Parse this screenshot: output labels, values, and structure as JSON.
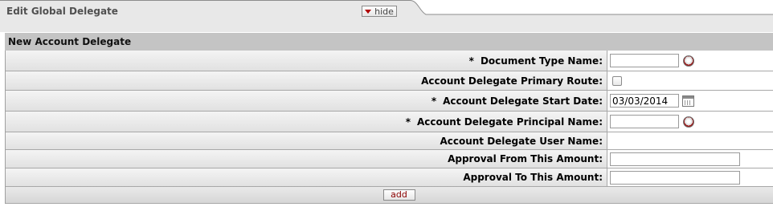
{
  "tab": {
    "title": "Edit Global Delegate",
    "hide_label": "hide"
  },
  "section": {
    "title": "New Account Delegate"
  },
  "fields": [
    {
      "label": "Document Type Name:",
      "required": "*",
      "value": ""
    },
    {
      "label": "Account Delegate Primary Route:",
      "required": ""
    },
    {
      "label": "Account Delegate Start Date:",
      "required": "*",
      "value": "03/03/2014"
    },
    {
      "label": "Account Delegate Principal Name:",
      "required": "*",
      "value": ""
    },
    {
      "label": "Account Delegate User Name:",
      "required": ""
    },
    {
      "label": "Approval From This Amount:",
      "required": "",
      "value": ""
    },
    {
      "label": "Approval To This Amount:",
      "required": "",
      "value": ""
    }
  ],
  "actions": {
    "add_label": "add"
  },
  "colors": {
    "header_gray": "#c4c4c4",
    "label_bg": "#e6e6e6",
    "accent_red": "#b00000"
  }
}
